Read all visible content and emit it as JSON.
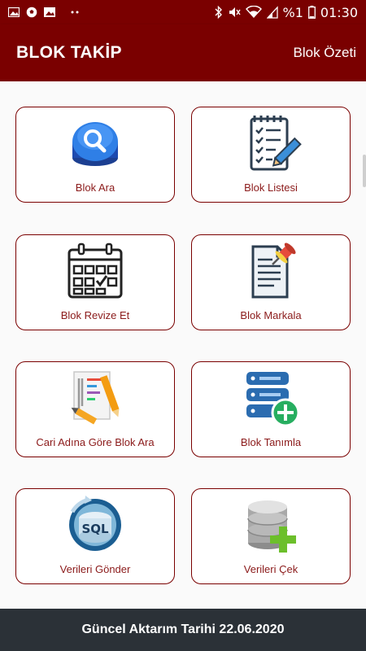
{
  "status_bar": {
    "battery_text": "%1",
    "time": "01:30",
    "icons": [
      "gallery-icon",
      "soccer-icon",
      "image-icon",
      "more-dots-icon",
      "bluetooth-icon",
      "mute-icon",
      "wifi-icon",
      "signal-icon",
      "battery-icon"
    ]
  },
  "header": {
    "title": "BLOK TAKİP",
    "action_label": "Blok Özeti"
  },
  "menu": {
    "items": [
      {
        "label": "Blok Ara",
        "icon": "search-button-icon"
      },
      {
        "label": "Blok Listesi",
        "icon": "checklist-icon"
      },
      {
        "label": "Blok Revize Et",
        "icon": "calendar-icon"
      },
      {
        "label": "Blok Markala",
        "icon": "pinned-document-icon"
      },
      {
        "label": "Cari Adına Göre Blok Ara",
        "icon": "document-pencil-icon"
      },
      {
        "label": "Blok Tanımla",
        "icon": "database-add-icon"
      },
      {
        "label": "Verileri Gönder",
        "icon": "sql-sync-icon"
      },
      {
        "label": "Verileri Çek",
        "icon": "database-plus-icon"
      }
    ]
  },
  "footer": {
    "text": "Güncel Aktarım Tarihi 22.06.2020"
  },
  "colors": {
    "primary": "#7a0000",
    "tile_border": "#7a0000",
    "tile_label": "#8b1a1a",
    "footer_bg": "#2b3137"
  }
}
